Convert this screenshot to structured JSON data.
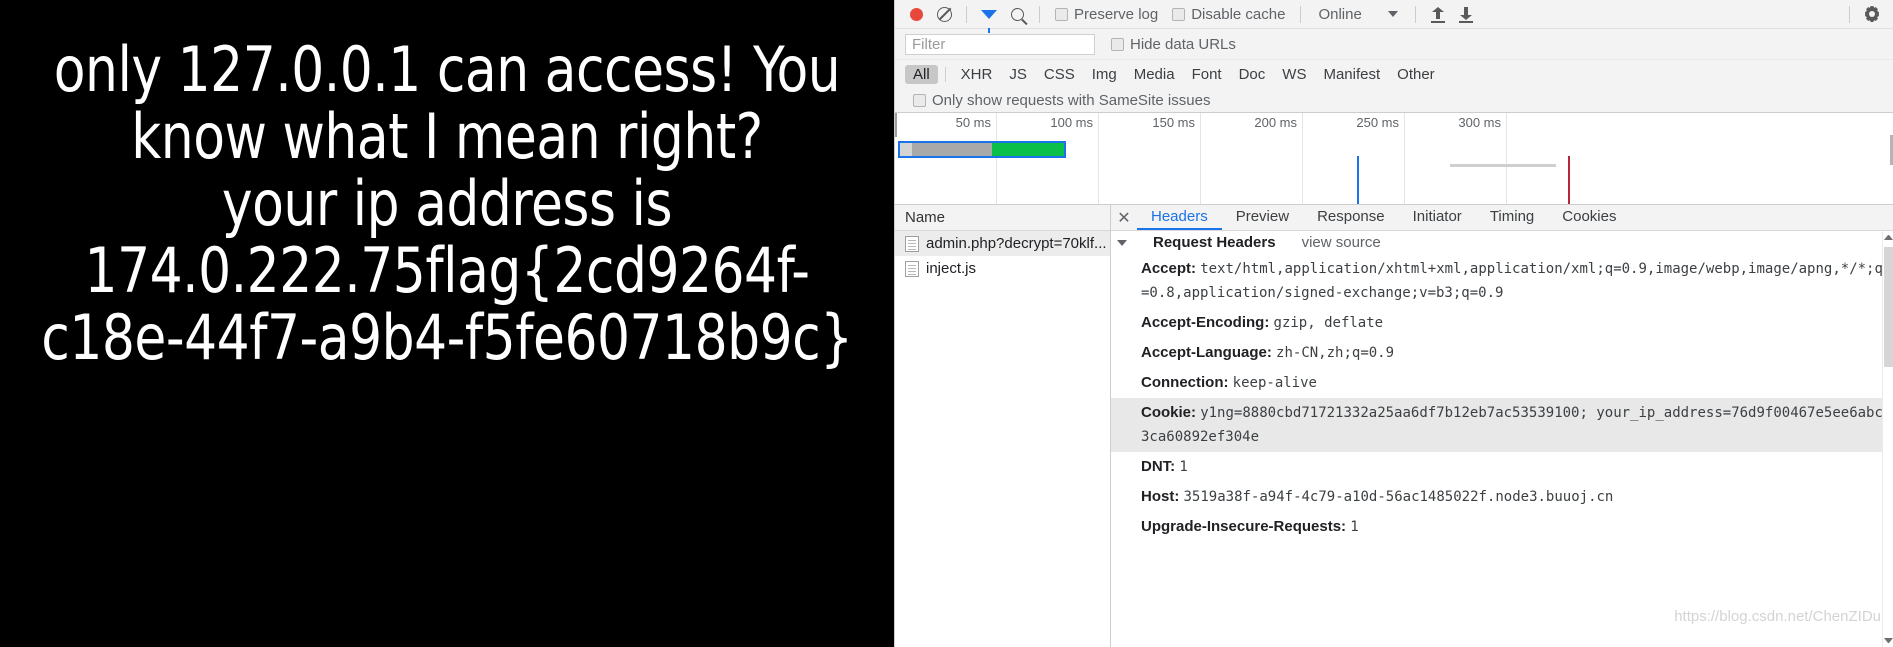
{
  "page": {
    "message": "only 127.0.0.1 can access! You know what I mean right?\nyour ip address is 174.0.222.75flag{2cd9264f-c18e-44f7-a9b4-f5fe60718b9c}",
    "background_color": "#000000",
    "text_color": "#ffffff"
  },
  "devtools": {
    "toolbar": {
      "record_label": "record-button",
      "clear_label": "clear-button",
      "filter_toggle_label": "filter-toggle",
      "search_label": "search-button",
      "preserve_log": "Preserve log",
      "disable_cache": "Disable cache",
      "throttling": "Online",
      "import_har": "import-har",
      "export_har": "export-har",
      "settings": "settings"
    },
    "filter": {
      "placeholder": "Filter",
      "value": "",
      "hide_data_urls": "Hide data URLs"
    },
    "types": [
      {
        "label": "All",
        "active": true
      },
      {
        "label": "XHR",
        "active": false
      },
      {
        "label": "JS",
        "active": false
      },
      {
        "label": "CSS",
        "active": false
      },
      {
        "label": "Img",
        "active": false
      },
      {
        "label": "Media",
        "active": false
      },
      {
        "label": "Font",
        "active": false
      },
      {
        "label": "Doc",
        "active": false
      },
      {
        "label": "WS",
        "active": false
      },
      {
        "label": "Manifest",
        "active": false
      },
      {
        "label": "Other",
        "active": false
      }
    ],
    "samesite_label": "Only show requests with SameSite issues",
    "overview": {
      "ticks": [
        "50 ms",
        "100 ms",
        "150 ms",
        "200 ms",
        "250 ms",
        "300 ms"
      ],
      "accent_blue": "#1a73e8",
      "accent_green": "#0bbf4b",
      "accent_red": "#b5273a",
      "accent_gray": "#a9a9a9"
    },
    "requests": {
      "column_header": "Name",
      "rows": [
        {
          "name": "admin.php?decrypt=70klf...",
          "selected": true
        },
        {
          "name": "inject.js",
          "selected": false
        }
      ]
    },
    "details": {
      "tabs": [
        {
          "label": "Headers",
          "active": true
        },
        {
          "label": "Preview",
          "active": false
        },
        {
          "label": "Response",
          "active": false
        },
        {
          "label": "Initiator",
          "active": false
        },
        {
          "label": "Timing",
          "active": false
        },
        {
          "label": "Cookies",
          "active": false
        }
      ],
      "section_title": "Request Headers",
      "view_source": "view source",
      "headers": [
        {
          "name": "Accept:",
          "value": "text/html,application/xhtml+xml,application/xml;q=0.9,image/webp,image/apng,*/*;q=0.8,application/signed-exchange;v=b3;q=0.9",
          "highlight": false
        },
        {
          "name": "Accept-Encoding:",
          "value": "gzip, deflate",
          "highlight": false
        },
        {
          "name": "Accept-Language:",
          "value": "zh-CN,zh;q=0.9",
          "highlight": false
        },
        {
          "name": "Connection:",
          "value": "keep-alive",
          "highlight": false
        },
        {
          "name": "Cookie:",
          "value": "y1ng=8880cbd71721332a25aa6df7b12eb7ac53539100; your_ip_address=76d9f00467e5ee6abc3ca60892ef304e",
          "highlight": true
        },
        {
          "name": "DNT:",
          "value": "1",
          "highlight": false
        },
        {
          "name": "Host:",
          "value": "3519a38f-a94f-4c79-a10d-56ac1485022f.node3.buuoj.cn",
          "highlight": false
        },
        {
          "name": "Upgrade-Insecure-Requests:",
          "value": "1",
          "highlight": false
        }
      ]
    },
    "watermark": "https://blog.csdn.net/ChenZIDu"
  }
}
